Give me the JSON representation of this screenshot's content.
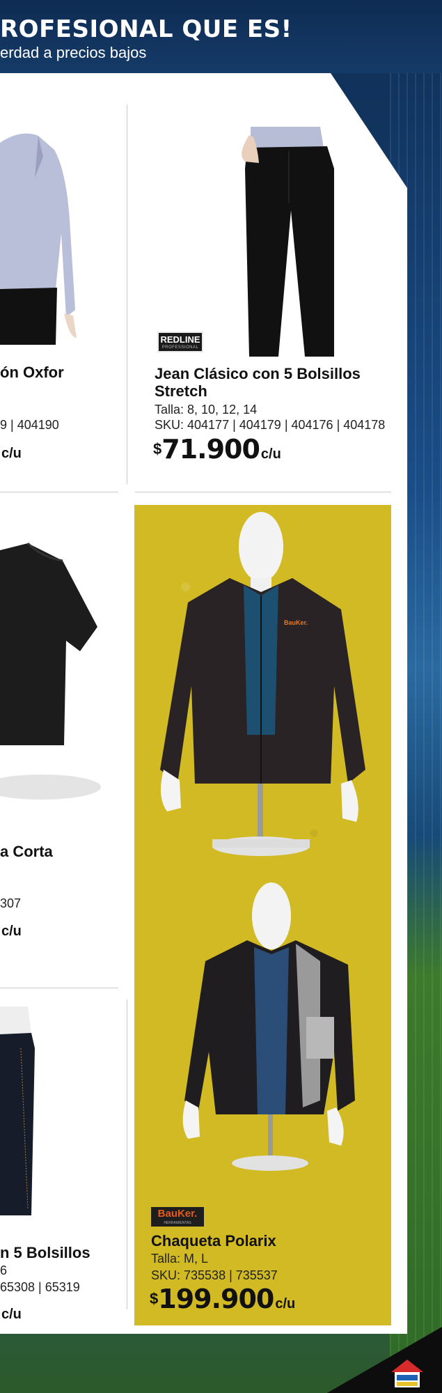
{
  "header": {
    "title": "ROFESIONAL QUE ES!",
    "subtitle": "erdad a precios bajos"
  },
  "products": {
    "oxford": {
      "name": "ón Oxfor",
      "sku": "9 | 404190",
      "unit": "c/u"
    },
    "jean_stretch": {
      "brand": "REDLINE",
      "brand_sub": "PROFESSIONAL",
      "name_line1": "Jean Clásico con 5 Bolsillos",
      "name_line2": "Stretch",
      "talla": "Talla: 8, 10, 12, 14",
      "sku": "SKU: 404177 | 404179 | 404176 | 404178",
      "currency": "$",
      "price": "71.900",
      "unit": "c/u"
    },
    "tshirt": {
      "name": "a Corta",
      "sku": "307",
      "unit": "c/u"
    },
    "jean_left": {
      "name": "n 5 Bolsillos",
      "talla": "6",
      "sku": "65308 | 65319",
      "unit": "c/u"
    },
    "chaqueta": {
      "brand": "BauKer.",
      "brand_sub": "HERRAMIENTAS",
      "jacket_logo": "BauKer.",
      "name": "Chaqueta Polarix",
      "talla": "Talla: M, L",
      "sku": "SKU: 735538 | 735537",
      "currency": "$",
      "price": "199.900",
      "unit": "c/u"
    }
  },
  "colors": {
    "header_bg": "#153b68",
    "promo_yellow": "#d1ba23",
    "brand_orange": "#e35a1f"
  }
}
